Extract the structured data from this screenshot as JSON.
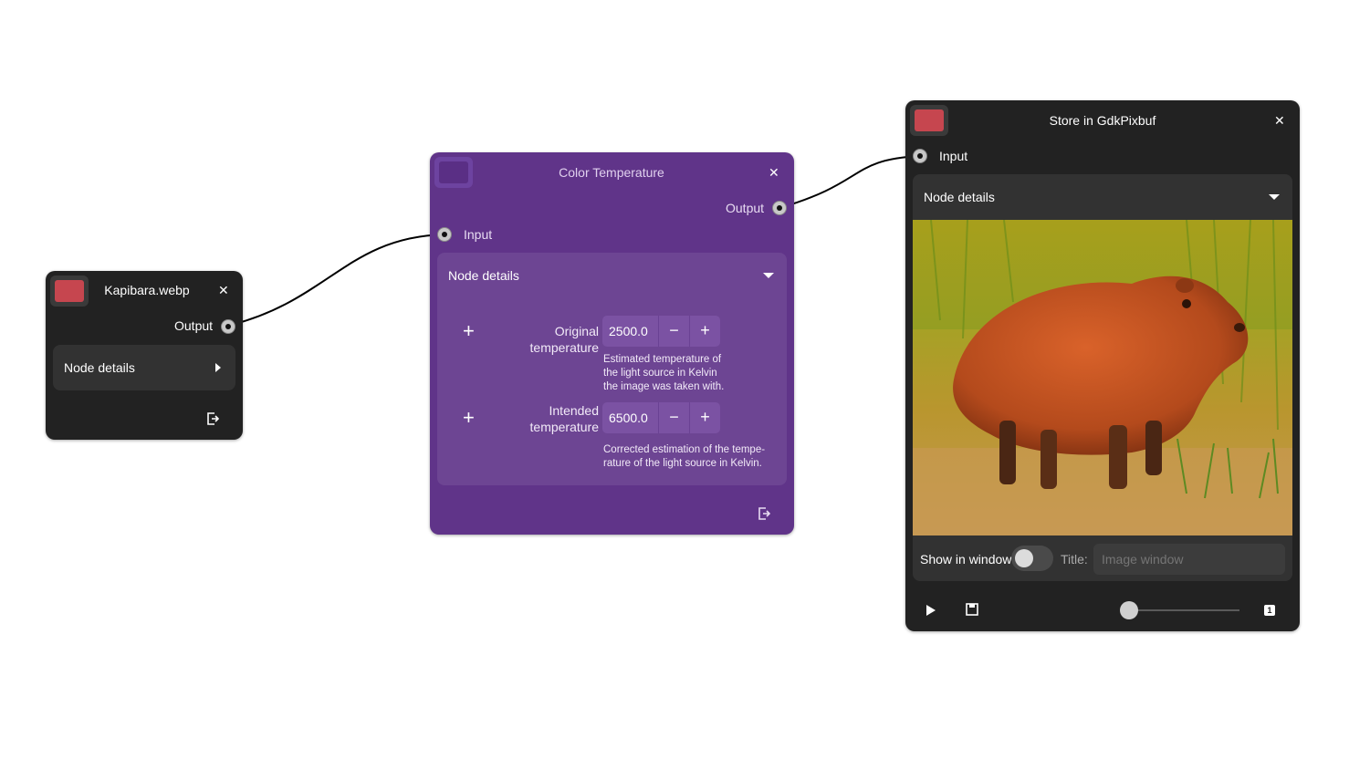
{
  "nodes": {
    "source": {
      "title": "Kapibara.webp",
      "output_label": "Output",
      "details_label": "Node details",
      "swatch_color": "#c6464f",
      "close_icon": "close-icon",
      "export_icon": "export-icon"
    },
    "color_temp": {
      "title": "Color Temperature",
      "output_label": "Output",
      "input_label": "Input",
      "details_label": "Node details",
      "close_icon": "close-icon",
      "params": [
        {
          "label": "Original temperature",
          "value": "2500.0",
          "description": "Estimated temperature of the light source in Kelvin the image was taken with."
        },
        {
          "label": "Intended temperature",
          "value": "6500.0",
          "description": "Corrected estimation of the tempe-rature of the light source in Kelvin."
        }
      ],
      "export_icon": "export-icon"
    },
    "sink": {
      "title": "Store in GdkPixbuf",
      "input_label": "Input",
      "details_label": "Node details",
      "swatch_color": "#c6464f",
      "show_in_window_label": "Show in window",
      "show_in_window": false,
      "title_label": "Title:",
      "title_placeholder": "Image window",
      "play_icon": "play-icon",
      "save_icon": "save-icon",
      "one_icon_label": "1",
      "slider_level": 0
    }
  },
  "colors": {
    "dark_node": "#222222",
    "purple_node": "#603489",
    "wire": "#000000"
  }
}
